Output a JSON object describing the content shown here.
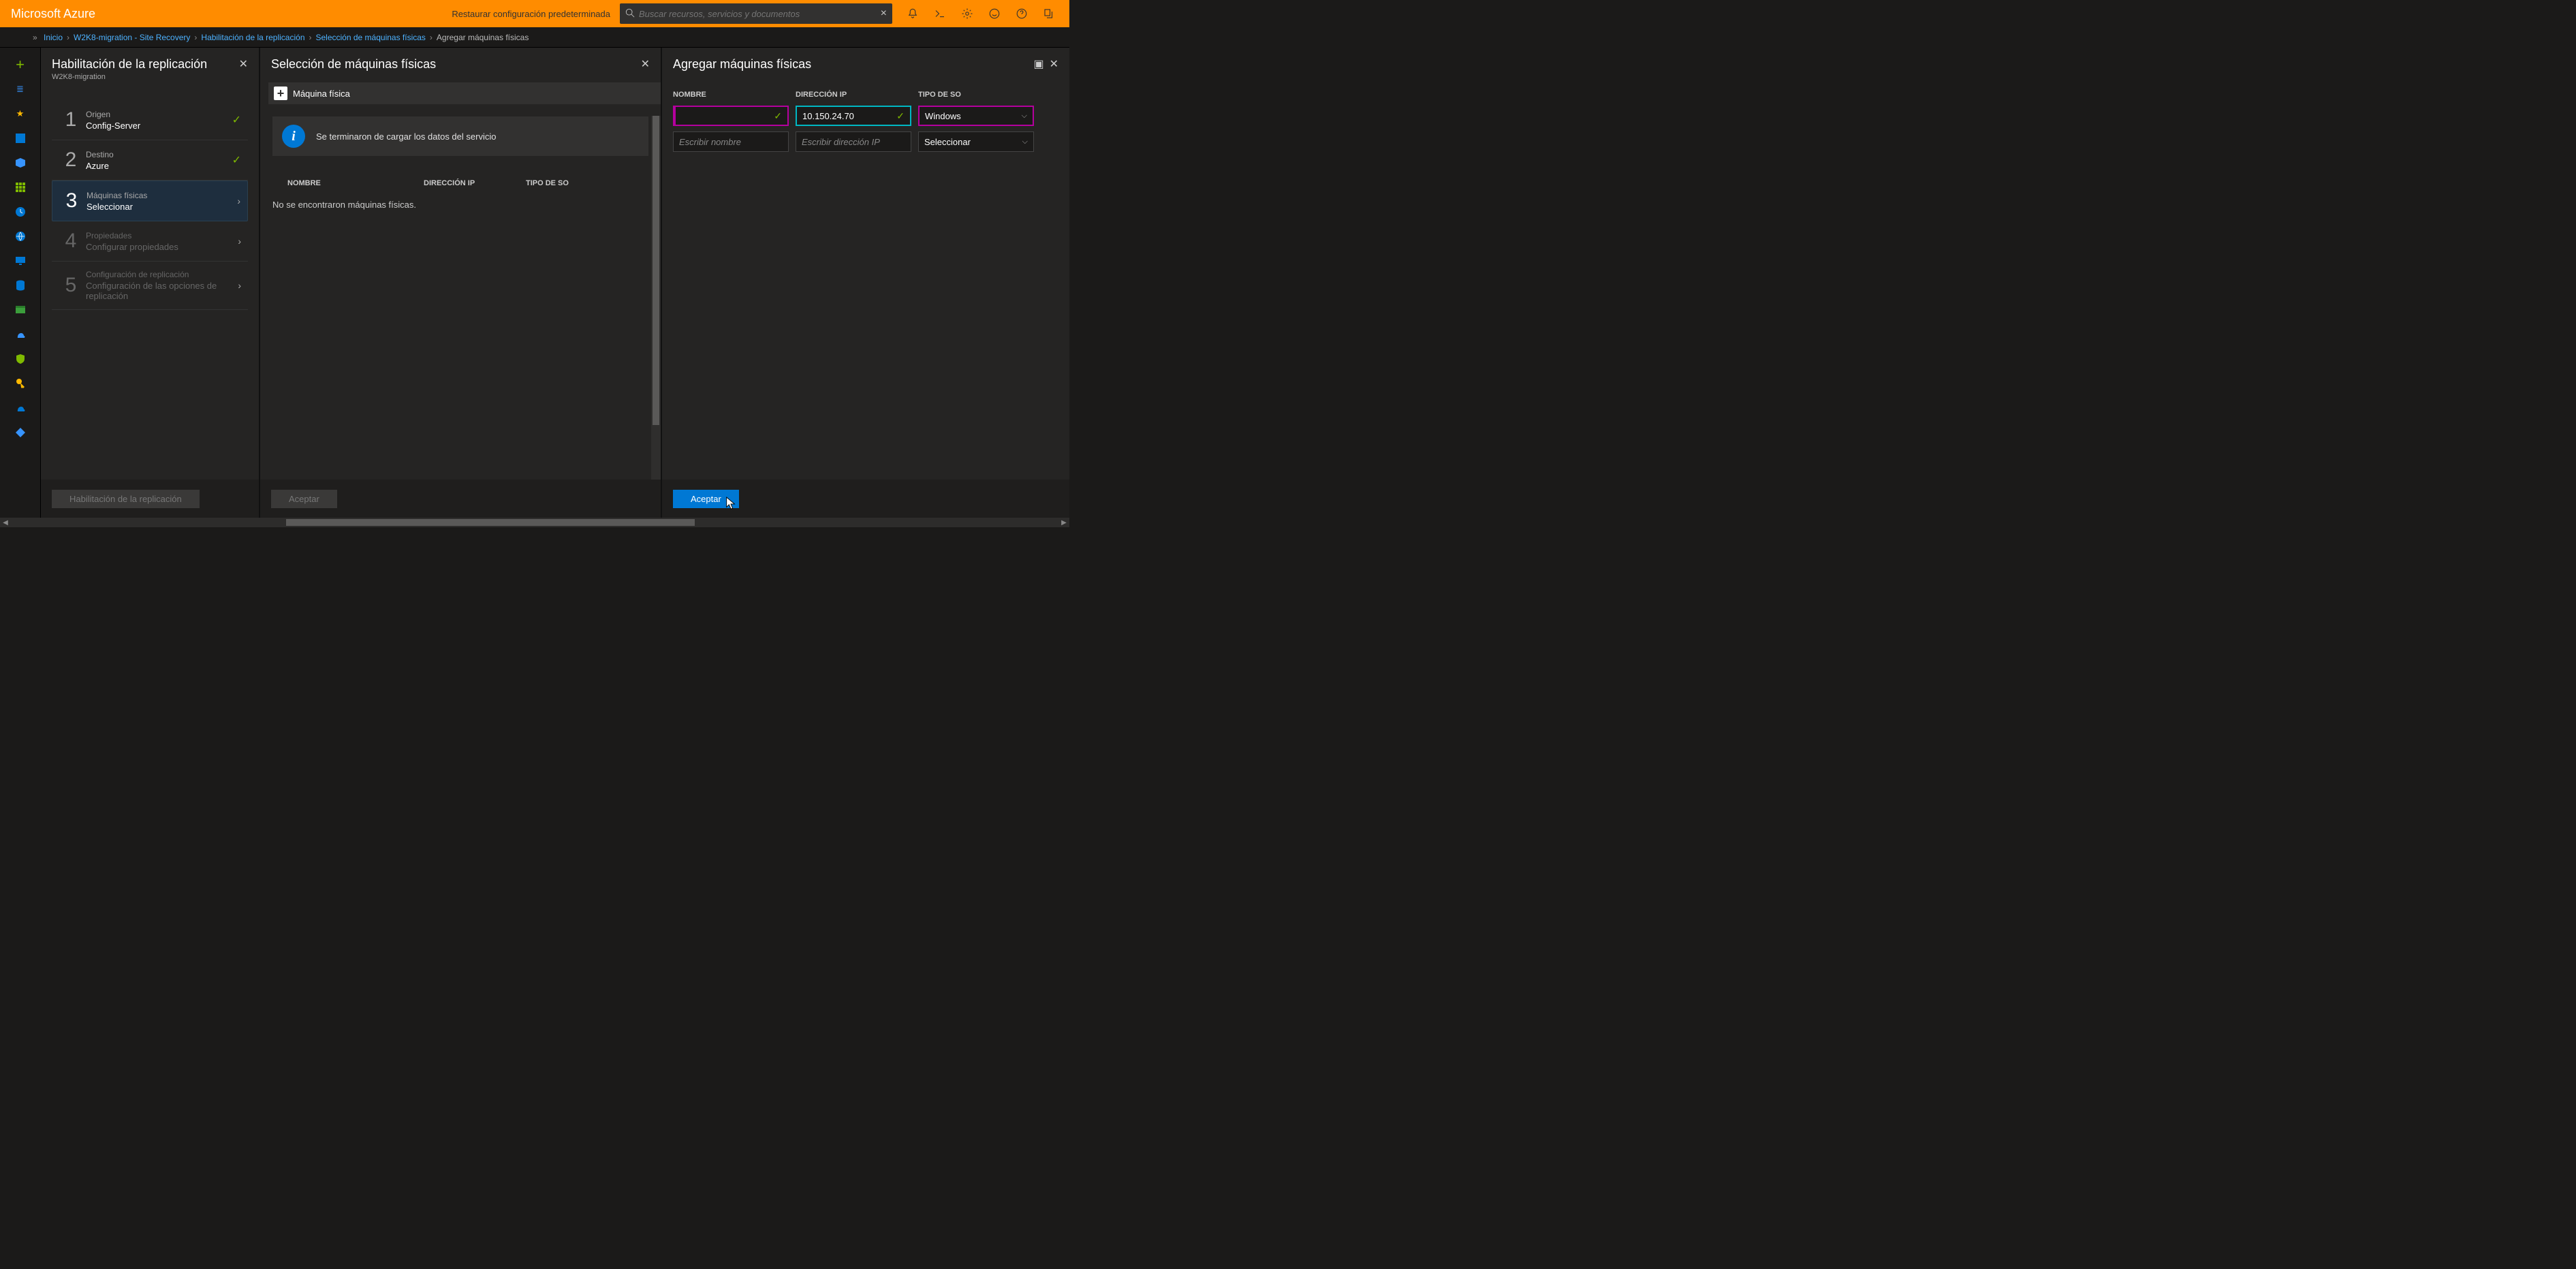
{
  "topbar": {
    "brand": "Microsoft Azure",
    "reset_link": "Restaurar configuración predeterminada",
    "search_placeholder": "Buscar recursos, servicios y documentos"
  },
  "breadcrumb": {
    "items": [
      {
        "label": "Inicio",
        "link": true
      },
      {
        "label": "W2K8-migration - Site Recovery",
        "link": true
      },
      {
        "label": "Habilitación de la replicación",
        "link": true
      },
      {
        "label": "Selección de máquinas físicas",
        "link": true
      },
      {
        "label": "Agregar máquinas físicas",
        "link": false
      }
    ]
  },
  "blade1": {
    "title": "Habilitación de la replicación",
    "subtitle": "W2K8-migration",
    "steps": [
      {
        "num": "1",
        "title": "Origen",
        "subtitle": "Config-Server",
        "status": "done"
      },
      {
        "num": "2",
        "title": "Destino",
        "subtitle": "Azure",
        "status": "done"
      },
      {
        "num": "3",
        "title": "Máquinas físicas",
        "subtitle": "Seleccionar",
        "status": "active"
      },
      {
        "num": "4",
        "title": "Propiedades",
        "subtitle": "Configurar propiedades",
        "status": "pending"
      },
      {
        "num": "5",
        "title": "Configuración de replicación",
        "subtitle": "Configuración de las opciones de replicación",
        "status": "pending"
      }
    ],
    "footer_button": "Habilitación de la replicación"
  },
  "blade2": {
    "title": "Selección de máquinas físicas",
    "add_button": "Máquina física",
    "info_message": "Se terminaron de cargar los datos del servicio",
    "columns": {
      "c1": "NOMBRE",
      "c2": "DIRECCIÓN IP",
      "c3": "TIPO DE SO"
    },
    "empty_message": "No se encontraron máquinas físicas.",
    "footer_button": "Aceptar"
  },
  "blade3": {
    "title": "Agregar máquinas físicas",
    "columns": {
      "c1": "NOMBRE",
      "c2": "DIRECCIÓN IP",
      "c3": "TIPO DE SO"
    },
    "row1": {
      "name": "",
      "ip": "10.150.24.70",
      "os": "Windows"
    },
    "row2": {
      "name_placeholder": "Escribir nombre",
      "ip_placeholder": "Escribir dirección IP",
      "os": "Seleccionar"
    },
    "footer_button": "Aceptar"
  },
  "nav_icons": [
    "plus",
    "list",
    "star",
    "dashboard",
    "cube",
    "grid",
    "clock",
    "globe",
    "monitor",
    "db",
    "storage",
    "cloud",
    "shield",
    "key",
    "cloud2",
    "diamond"
  ],
  "top_icons": [
    "bell",
    "console",
    "gear",
    "smile",
    "help",
    "feedback"
  ],
  "colors": {
    "accent_orange": "#ff8c00",
    "accent_blue": "#0078d4",
    "validated_green": "#7fba00",
    "highlight_magenta": "#b4009e",
    "highlight_cyan": "#00b7c3"
  }
}
